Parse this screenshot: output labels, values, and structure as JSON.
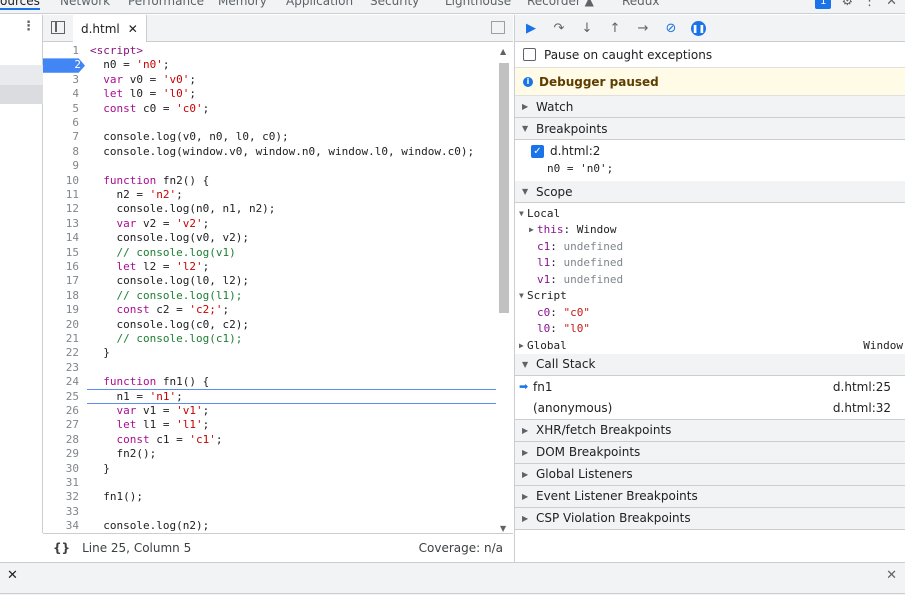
{
  "tabs": [
    "ources",
    "Network",
    "Performance",
    "Memory",
    "Application",
    "Security",
    "Lighthouse",
    "Recorder ▲",
    "Redux"
  ],
  "tabbar_badge": "1",
  "editor": {
    "file_tab": "d.html",
    "lines": [
      {
        "n": "1",
        "html": "<span class=\"tag\">&lt;script&gt;</span>"
      },
      {
        "n": "2",
        "html": "  n0 = <span class=\"str\">'n0'</span>;"
      },
      {
        "n": "3",
        "html": "  <span class=\"kw\">var</span> v0 = <span class=\"str\">'v0'</span>;"
      },
      {
        "n": "4",
        "html": "  <span class=\"kw\">let</span> l0 = <span class=\"str\">'l0'</span>;"
      },
      {
        "n": "5",
        "html": "  <span class=\"kw\">const</span> c0 = <span class=\"str\">'c0'</span>;"
      },
      {
        "n": "6",
        "html": ""
      },
      {
        "n": "7",
        "html": "  console.log(v0, n0, l0, c0);"
      },
      {
        "n": "8",
        "html": "  console.log(window.v0, window.n0, window.l0, window.c0);"
      },
      {
        "n": "9",
        "html": ""
      },
      {
        "n": "10",
        "html": "  <span class=\"kw\">function</span> fn2() {"
      },
      {
        "n": "11",
        "html": "    n2 = <span class=\"str\">'n2'</span>;"
      },
      {
        "n": "12",
        "html": "    console.log(n0, n1, n2);"
      },
      {
        "n": "13",
        "html": "    <span class=\"kw\">var</span> v2 = <span class=\"str\">'v2'</span>;"
      },
      {
        "n": "14",
        "html": "    console.log(v0, v2);"
      },
      {
        "n": "15",
        "html": "    <span class=\"cm\">// console.log(v1)</span>"
      },
      {
        "n": "16",
        "html": "    <span class=\"kw\">let</span> l2 = <span class=\"str\">'l2'</span>;"
      },
      {
        "n": "17",
        "html": "    console.log(l0, l2);"
      },
      {
        "n": "18",
        "html": "    <span class=\"cm\">// console.log(l1);</span>"
      },
      {
        "n": "19",
        "html": "    <span class=\"kw\">const</span> c2 = <span class=\"str\">'c2;'</span>;"
      },
      {
        "n": "20",
        "html": "    console.log(c0, c2);"
      },
      {
        "n": "21",
        "html": "    <span class=\"cm\">// console.log(c1);</span>"
      },
      {
        "n": "22",
        "html": "  }"
      },
      {
        "n": "23",
        "html": ""
      },
      {
        "n": "24",
        "html": "  <span class=\"kw\">function</span> fn1() {"
      },
      {
        "n": "25",
        "html": "    n1 = <span class=\"str\">'n1'</span>;"
      },
      {
        "n": "26",
        "html": "    <span class=\"kw\">var</span> v1 = <span class=\"str\">'v1'</span>;"
      },
      {
        "n": "27",
        "html": "    <span class=\"kw\">let</span> l1 = <span class=\"str\">'l1'</span>;"
      },
      {
        "n": "28",
        "html": "    <span class=\"kw\">const</span> c1 = <span class=\"str\">'c1'</span>;"
      },
      {
        "n": "29",
        "html": "    fn2();"
      },
      {
        "n": "30",
        "html": "  }"
      },
      {
        "n": "31",
        "html": ""
      },
      {
        "n": "32",
        "html": "  fn1();"
      },
      {
        "n": "33",
        "html": ""
      },
      {
        "n": "34",
        "html": "  console.log(n2);"
      }
    ],
    "breakpoint_line": "2",
    "current_line": "25"
  },
  "status": {
    "position": "Line 25, Column 5",
    "coverage": "Coverage: n/a"
  },
  "debugger": {
    "pause_on_caught_label": "Pause on caught exceptions",
    "paused_label": "Debugger paused",
    "watch_label": "Watch",
    "breakpoints_label": "Breakpoints",
    "breakpoint_entry": {
      "location": "d.html:2",
      "code": "n0 = 'n0';"
    },
    "scope_label": "Scope",
    "local_label": "Local",
    "local_vars": [
      {
        "name": "this",
        "value": "Window",
        "expandable": true
      },
      {
        "name": "c1",
        "value": "undefined"
      },
      {
        "name": "l1",
        "value": "undefined"
      },
      {
        "name": "v1",
        "value": "undefined"
      }
    ],
    "script_label": "Script",
    "script_vars": [
      {
        "name": "c0",
        "value": "\"c0\""
      },
      {
        "name": "l0",
        "value": "\"l0\""
      }
    ],
    "global_label": "Global",
    "global_value": "Window",
    "call_stack_label": "Call Stack",
    "frames": [
      {
        "name": "fn1",
        "location": "d.html:25"
      },
      {
        "name": "(anonymous)",
        "location": "d.html:32"
      }
    ],
    "sections": [
      "XHR/fetch Breakpoints",
      "DOM Breakpoints",
      "Global Listeners",
      "Event Listener Breakpoints",
      "CSP Violation Breakpoints"
    ]
  }
}
